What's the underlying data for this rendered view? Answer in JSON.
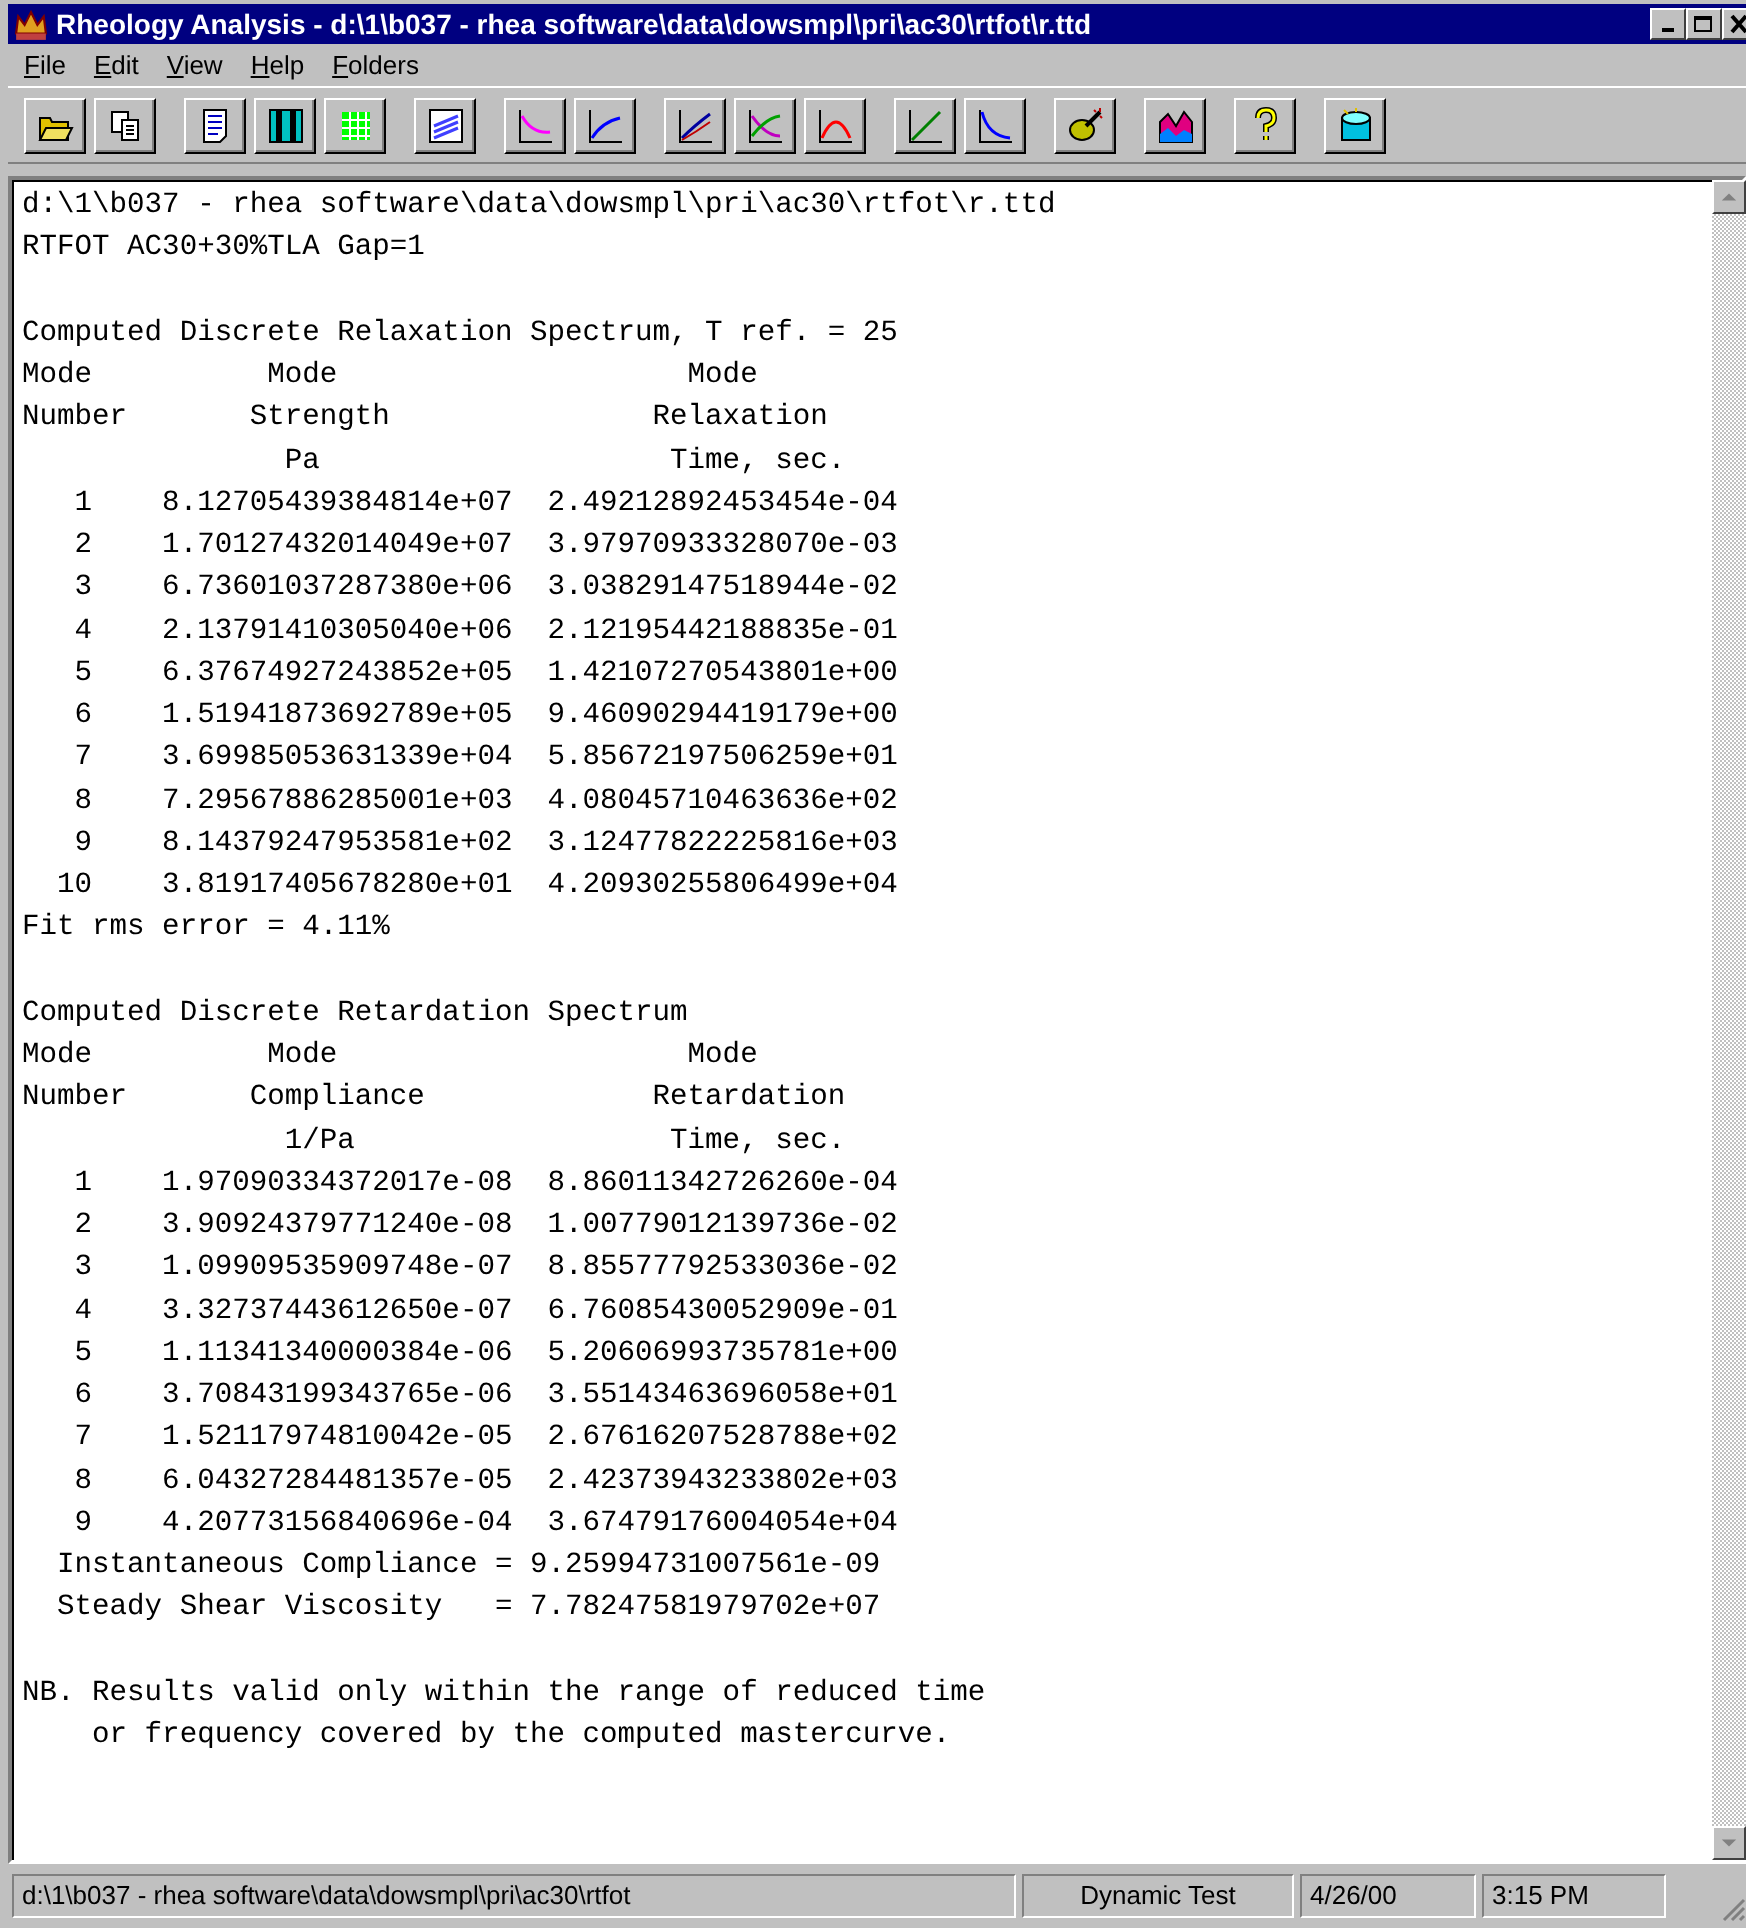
{
  "window": {
    "title": "Rheology Analysis - d:\\1\\b037 - rhea software\\data\\dowsmpl\\pri\\ac30\\rtfot\\r.ttd"
  },
  "menu": [
    "File",
    "Edit",
    "View",
    "Help",
    "Folders"
  ],
  "toolbar": [
    [
      {
        "kind": "open"
      },
      {
        "kind": "copy"
      }
    ],
    [
      {
        "kind": "text"
      },
      {
        "kind": "columns"
      },
      {
        "kind": "grid"
      }
    ],
    [
      {
        "kind": "lines"
      }
    ],
    [
      {
        "kind": "fall"
      },
      {
        "kind": "rise"
      }
    ],
    [
      {
        "kind": "rise2"
      },
      {
        "kind": "cross"
      },
      {
        "kind": "arch"
      }
    ],
    [
      {
        "kind": "diag"
      },
      {
        "kind": "decay"
      }
    ],
    [
      {
        "kind": "wand"
      }
    ],
    [
      {
        "kind": "area"
      }
    ],
    [
      {
        "kind": "help"
      }
    ],
    [
      {
        "kind": "drum"
      }
    ]
  ],
  "document": {
    "blocks": [
      [
        "d:\\1\\b037 - rhea software\\data\\dowsmpl\\pri\\ac30\\rtfot\\r.ttd",
        "RTFOT AC30+30%TLA Gap=1"
      ],
      [
        "Computed Discrete Relaxation Spectrum, T ref. = 25",
        "Mode          Mode                    Mode",
        "Number       Strength               Relaxation",
        "               Pa                    Time, sec.",
        "   1    8.12705439384814e+07  2.49212892453454e-04",
        "   2    1.70127432014049e+07  3.97970933328070e-03",
        "   3    6.73601037287380e+06  3.03829147518944e-02",
        "   4    2.13791410305040e+06  2.12195442188835e-01",
        "   5    6.37674927243852e+05  1.42107270543801e+00",
        "   6    1.51941873692789e+05  9.46090294419179e+00",
        "   7    3.69985053631339e+04  5.85672197506259e+01",
        "   8    7.29567886285001e+03  4.08045710463636e+02",
        "   9    8.14379247953581e+02  3.12477822225816e+03",
        "  10    3.81917405678280e+01  4.20930255806499e+04",
        "Fit rms error = 4.11%"
      ],
      [
        "Computed Discrete Retardation Spectrum",
        "Mode          Mode                    Mode",
        "Number       Compliance             Retardation",
        "               1/Pa                  Time, sec.",
        "   1    1.97090334372017e-08  8.86011342726260e-04",
        "   2    3.90924379771240e-08  1.00779012139736e-02",
        "   3    1.09909535909748e-07  8.85577792533036e-02",
        "   4    3.32737443612650e-07  6.76085430052909e-01",
        "   5    1.11341340000384e-06  5.20606993735781e+00",
        "   6    3.70843199343765e-06  3.55143463696058e+01",
        "   7    1.52117974810042e-05  2.67616207528788e+02",
        "   8    6.04327284481357e-05  2.42373943233802e+03",
        "   9    4.20773156840696e-04  3.67479176004054e+04",
        "  Instantaneous Compliance = 9.25994731007561e-09",
        "  Steady Shear Viscosity   = 7.78247581979702e+07"
      ],
      [
        "NB. Results valid only within the range of reduced time",
        "    or frequency covered by the computed mastercurve."
      ]
    ]
  },
  "status_bar": [
    "d:\\1\\b037 - rhea software\\data\\dowsmpl\\pri\\ac30\\rtfot",
    "Dynamic Test",
    "4/26/00",
    "3:15 PM"
  ]
}
